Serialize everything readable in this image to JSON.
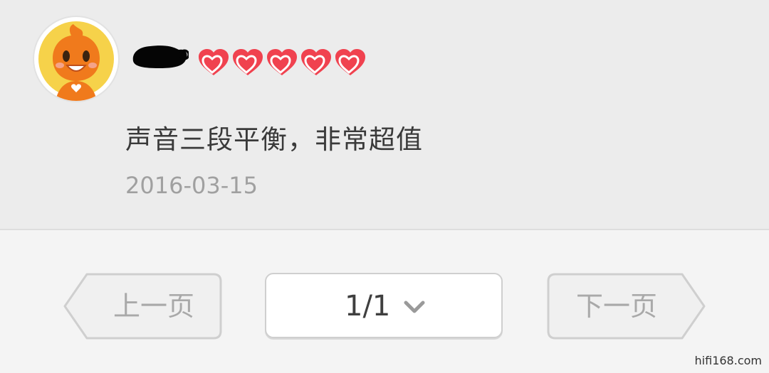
{
  "review": {
    "rating_stars": 5,
    "text": "声音三段平衡，非常超值",
    "date": "2016-03-15"
  },
  "pager": {
    "prev_label": "上一页",
    "page_indicator": "1/1",
    "next_label": "下一页"
  },
  "watermark": "hifi168.com",
  "colors": {
    "heart": "#f0424f",
    "review_bg": "#ececec",
    "page_bg": "#f4f4f4"
  }
}
